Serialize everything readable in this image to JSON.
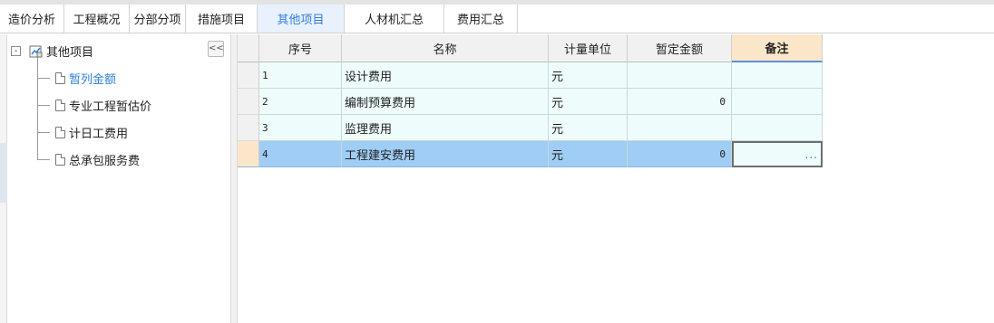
{
  "tabs": [
    {
      "label": "造价分析"
    },
    {
      "label": "工程概况"
    },
    {
      "label": "分部分项"
    },
    {
      "label": "措施项目"
    },
    {
      "label": "其他项目"
    },
    {
      "label": "人材机汇总"
    },
    {
      "label": "费用汇总"
    }
  ],
  "active_tab": "其他项目",
  "tree": {
    "collapse_glyph": "<<",
    "root": {
      "expander": "-",
      "label": "其他项目"
    },
    "children": [
      {
        "label": "暂列金额",
        "selected": true
      },
      {
        "label": "专业工程暂估价",
        "selected": false
      },
      {
        "label": "计日工费用",
        "selected": false
      },
      {
        "label": "总承包服务费",
        "selected": false
      }
    ]
  },
  "grid": {
    "columns": [
      "序号",
      "名称",
      "计量单位",
      "暂定金额",
      "备注"
    ],
    "rows": [
      {
        "seq": "1",
        "name": "设计费用",
        "unit": "元",
        "amount": "",
        "remark": ""
      },
      {
        "seq": "2",
        "name": "编制预算费用",
        "unit": "元",
        "amount": "0",
        "remark": ""
      },
      {
        "seq": "3",
        "name": "监理费用",
        "unit": "元",
        "amount": "",
        "remark": ""
      },
      {
        "seq": "4",
        "name": "工程建安费用",
        "unit": "元",
        "amount": "0",
        "remark": "..."
      }
    ],
    "selected_row": 4,
    "active_column": "备注"
  },
  "colors": {
    "accent": "#2f7fd8",
    "selected_row": "#9fcdf5",
    "row_background": "#eefcfc",
    "active_header": "#fbe6c9"
  }
}
